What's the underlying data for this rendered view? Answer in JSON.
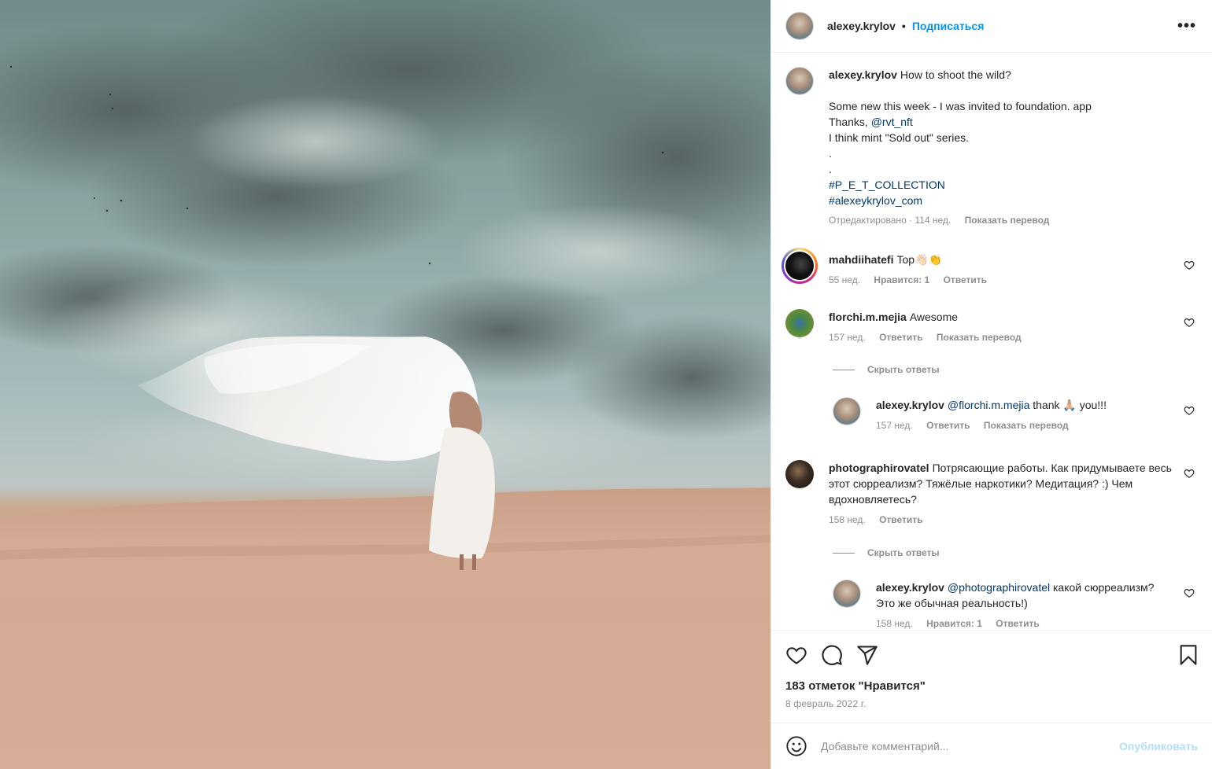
{
  "post": {
    "author": "alexey.krylov",
    "dot": "•",
    "follow_label": "Подписаться",
    "more_label": "•••"
  },
  "caption": {
    "username": "alexey.krylov",
    "line1": "How to shoot the wild?",
    "line2": "Some new this week - I was invited to foundation. app",
    "line3_prefix": "Thanks, ",
    "line3_mention": "@rvt_nft",
    "line4": "I think mint \"Sold out\" series.",
    "dot1": ".",
    "dot2": ".",
    "hashtag1": "#P_E_T_COLLECTION",
    "hashtag2": "#alexeykrylov_com",
    "edited": "Отредактировано · 114 нед.",
    "show_translation": "Показать перевод"
  },
  "comments": [
    {
      "username": "mahdiihatefi",
      "text": "Top👋🏻👏",
      "time": "55 нед.",
      "likes": "Нравится: 1",
      "reply": "Ответить"
    },
    {
      "username": "florchi.m.mejia",
      "text": "Awesome",
      "time": "157 нед.",
      "reply": "Ответить",
      "translate": "Показать перевод",
      "hide_replies": "Скрыть ответы",
      "replies": [
        {
          "username": "alexey.krylov",
          "mention": "@florchi.m.mejia",
          "text": " thank 🙏🏼 you!!!",
          "time": "157 нед.",
          "reply": "Ответить",
          "translate": "Показать перевод"
        }
      ]
    },
    {
      "username": "photographirovatel",
      "text": "Потрясающие работы. Как придумываете весь этот сюрреализм? Тяжёлые наркотики? Медитация? :) Чем вдохновляетесь?",
      "time": "158 нед.",
      "reply": "Ответить",
      "hide_replies": "Скрыть ответы",
      "replies": [
        {
          "username": "alexey.krylov",
          "mention": "@photographirovatel",
          "text": " какой сюрреализм? Это же обычная реальность!)",
          "time": "158 нед.",
          "likes": "Нравится: 1",
          "reply": "Ответить"
        }
      ]
    }
  ],
  "actions": {
    "likes": "183 отметок \"Нравится\"",
    "date": "8 февраль 2022 г."
  },
  "add_comment": {
    "placeholder": "Добавьте комментарий...",
    "publish": "Опубликовать"
  },
  "icons": [
    "heart-icon",
    "comment-icon",
    "share-icon",
    "bookmark-icon",
    "emoji-icon",
    "more-icon"
  ]
}
